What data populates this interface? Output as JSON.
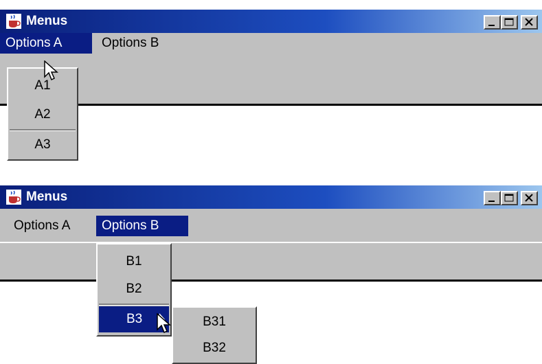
{
  "window_top": {
    "title": "Menus",
    "menus": [
      "Options A",
      "Options B"
    ],
    "popup_items": [
      "A1",
      "A2",
      "A3"
    ]
  },
  "window_bottom": {
    "title": "Menus",
    "menus": [
      "Options A",
      "Options B"
    ],
    "popup_items": [
      "B1",
      "B2",
      "B3"
    ],
    "submenu_items": [
      "B31",
      "B32"
    ]
  },
  "colors": {
    "menu_highlight": "#0a1d84",
    "title_gradient_start": "#0a1f7a",
    "title_gradient_end": "#9cc6ee",
    "chrome": "#c0c0c0"
  },
  "icons": [
    "java-cup-icon",
    "minimize-icon",
    "maximize-icon",
    "close-icon",
    "mouse-pointer-icon",
    "submenu-arrow-icon"
  ]
}
